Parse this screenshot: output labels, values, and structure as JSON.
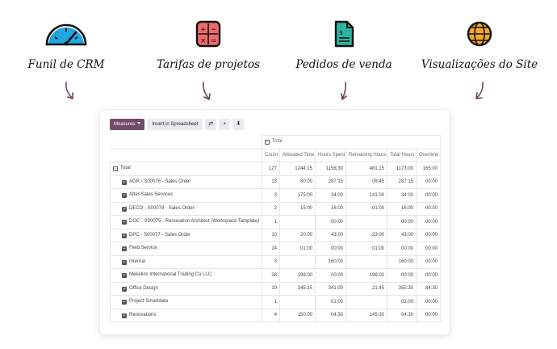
{
  "features": [
    {
      "label": "Funil de CRM",
      "icon": "speedometer-icon"
    },
    {
      "label": "Tarifas de projetos",
      "icon": "calculator-icon"
    },
    {
      "label": "Pedidos de venda",
      "icon": "document-icon"
    },
    {
      "label": "Visualizações do Site",
      "icon": "globe-icon"
    }
  ],
  "toolbar": {
    "measures_label": "Measures",
    "insert_label": "Insert in Spreadsheet",
    "flip_icon": "⇄",
    "expand_icon": "+",
    "download_icon": "⬇"
  },
  "table": {
    "header_total": "Total",
    "columns": [
      "Count",
      "Allocated Time",
      "Hours Spent",
      "Remaining Hours",
      "Total Hours",
      "Overtime"
    ],
    "total_row": {
      "label": "Total",
      "values": [
        "127",
        "1244:15",
        "1158:30",
        "481:15",
        "1173:00",
        "165:00"
      ]
    },
    "rows": [
      {
        "label": "AGR - S00076 - Sales Order",
        "values": [
          "13",
          "80:00",
          "287:15",
          "09:45",
          "287:15",
          "00:00"
        ]
      },
      {
        "label": "After-Sales Services",
        "values": [
          "3",
          "175:00",
          "34:00",
          "141:00",
          "34:00",
          "00:00"
        ]
      },
      {
        "label": "DECO - S00078 - Sales Order",
        "values": [
          "2",
          "15:00",
          "16:00",
          "-01:00",
          "16:00",
          "00:00"
        ]
      },
      {
        "label": "DOC - S00075 - Renovation Architect (Workspace Template)",
        "values": [
          "1",
          "",
          "00:00",
          "",
          "00:00",
          "00:00"
        ]
      },
      {
        "label": "DPC - S00077 - Sales Order",
        "values": [
          "10",
          "20:00",
          "43:00",
          "-23:00",
          "43:00",
          "00:00"
        ]
      },
      {
        "label": "Field Service",
        "values": [
          "24",
          "01:00",
          "00:00",
          "01:00",
          "00:00",
          "00:00"
        ]
      },
      {
        "label": "Internal",
        "values": [
          "3",
          "",
          "160:00",
          "",
          "160:00",
          "00:00"
        ]
      },
      {
        "label": "Mekelins International Trading Co LLC",
        "values": [
          "38",
          "196:00",
          "00:00",
          "196:00",
          "00:00",
          "00:00"
        ]
      },
      {
        "label": "Office Design",
        "values": [
          "19",
          "345:15",
          "341:00",
          "21:45",
          "355:30",
          "84:30"
        ]
      },
      {
        "label": "Project Smartdata",
        "values": [
          "1",
          "",
          "01:00",
          "",
          "01:00",
          "00:00"
        ]
      },
      {
        "label": "Renovations",
        "values": [
          "4",
          "150:00",
          "04:30",
          "145:30",
          "04:30",
          "00:00"
        ]
      }
    ]
  }
}
